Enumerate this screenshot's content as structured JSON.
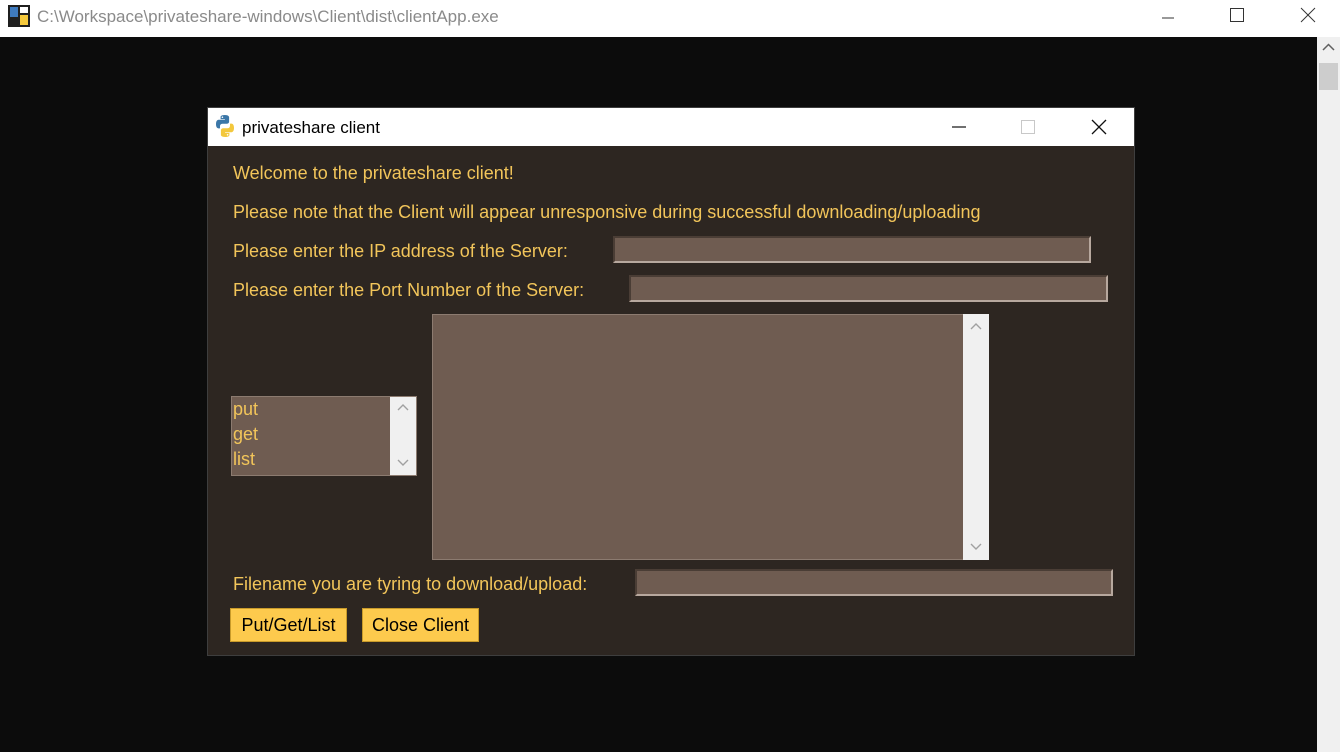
{
  "outer_window": {
    "title": "C:\\Workspace\\privateshare-windows\\Client\\dist\\clientApp.exe"
  },
  "dialog": {
    "title": "privateshare client",
    "welcome": "Welcome to the privateshare client!",
    "note": "Please note that the Client will appear unresponsive during successful downloading/uploading",
    "ip_label": "Please enter the IP address of the Server:",
    "ip_value": "",
    "port_label": "Please enter the Port Number of the Server:",
    "port_value": "",
    "commands": [
      "put",
      "get",
      "list"
    ],
    "output_text": "",
    "filename_label": "Filename you are tyring to download/upload:",
    "filename_value": "",
    "action_button": "Put/Get/List",
    "close_button": "Close Client"
  },
  "colors": {
    "background": "#2d2621",
    "text": "#f2c55a",
    "field": "#6f5c51",
    "button": "#fdca4d"
  }
}
